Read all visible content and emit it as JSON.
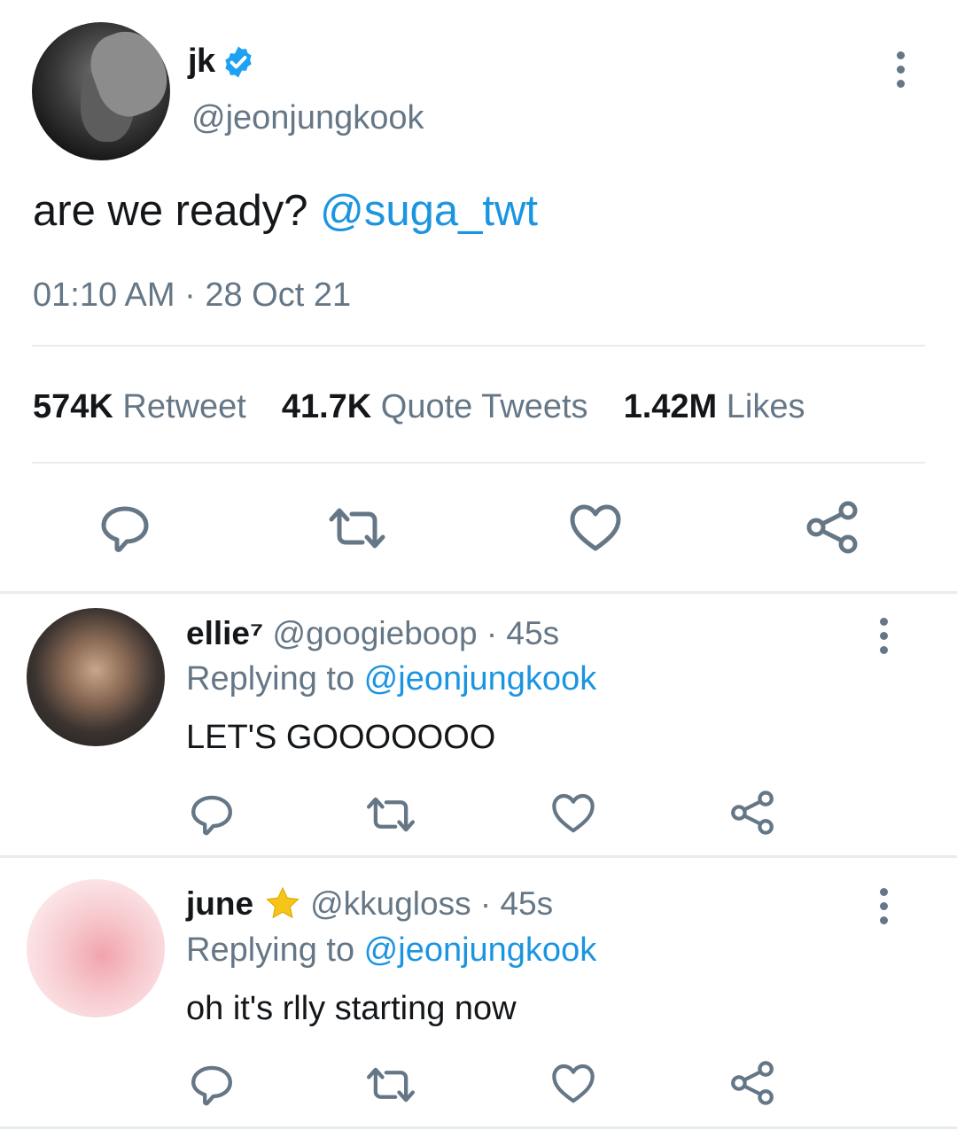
{
  "tweet": {
    "author": {
      "name": "jk",
      "handle": "@jeonjungkook",
      "verified": true
    },
    "text": "are we ready? ",
    "mention": "@suga_twt",
    "timestamp": "01:10 AM · 28 Oct 21",
    "stats": {
      "retweets_count": "574K",
      "retweets_label": "Retweet",
      "quotes_count": "41.7K",
      "quotes_label": "Quote Tweets",
      "likes_count": "1.42M",
      "likes_label": "Likes"
    },
    "actions": [
      "reply-icon",
      "retweet-icon",
      "like-icon",
      "share-icon"
    ]
  },
  "replies": [
    {
      "name": "ellie⁷",
      "handle": "@googieboop",
      "time": "· 45s",
      "replying_label": "Replying to ",
      "replying_to": "@jeonjungkook",
      "text": "LET'S GOOOOOOO"
    },
    {
      "name": "june",
      "badge_icon": "star-icon",
      "handle": "@kkugloss",
      "time": "· 45s",
      "replying_label": "Replying to ",
      "replying_to": "@jeonjungkook",
      "text": "oh it's rlly starting now"
    }
  ],
  "colors": {
    "accent": "#1b95e0",
    "secondary_text": "#657786",
    "divider": "#e6ecf0",
    "star": "#f5c518"
  }
}
